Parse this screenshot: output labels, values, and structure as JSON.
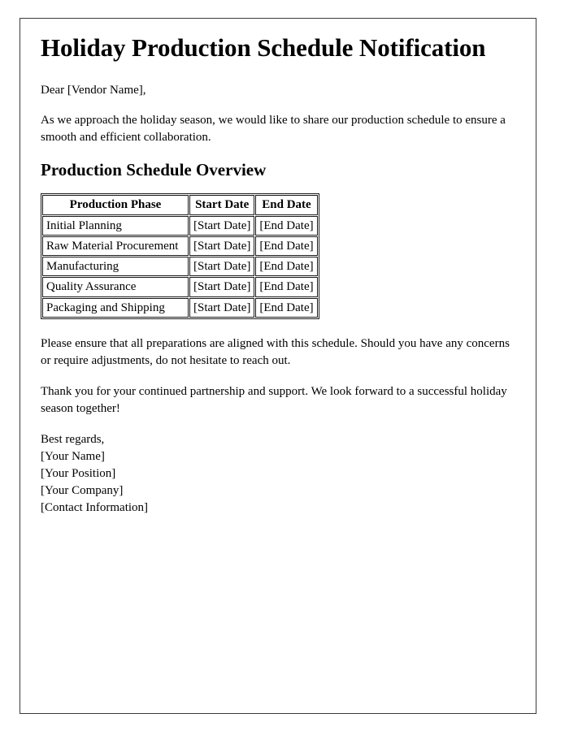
{
  "document": {
    "title": "Holiday Production Schedule Notification",
    "salutation": "Dear [Vendor Name],",
    "intro_paragraph": "As we approach the holiday season, we would like to share our production schedule to ensure a smooth and efficient collaboration.",
    "section_heading": "Production Schedule Overview",
    "closing_paragraph_1": "Please ensure that all preparations are aligned with this schedule. Should you have any concerns or require adjustments, do not hesitate to reach out.",
    "closing_paragraph_2": "Thank you for your continued partnership and support. We look forward to a successful holiday season together!"
  },
  "schedule_table": {
    "columns": [
      "Production Phase",
      "Start Date",
      "End Date"
    ],
    "rows": [
      {
        "phase": "Initial Planning",
        "start": "[Start Date]",
        "end": "[End Date]"
      },
      {
        "phase": "Raw Material Procurement",
        "start": "[Start Date]",
        "end": "[End Date]"
      },
      {
        "phase": "Manufacturing",
        "start": "[Start Date]",
        "end": "[End Date]"
      },
      {
        "phase": "Quality Assurance",
        "start": "[Start Date]",
        "end": "[End Date]"
      },
      {
        "phase": "Packaging and Shipping",
        "start": "[Start Date]",
        "end": "[End Date]"
      }
    ]
  },
  "signature": {
    "closing": "Best regards,",
    "name": "[Your Name]",
    "position": "[Your Position]",
    "company": "[Your Company]",
    "contact": "[Contact Information]"
  },
  "colors": {
    "page_background": "#ffffff",
    "text": "#000000",
    "page_border": "#3a3a3a",
    "table_border": "#1a1a1a"
  }
}
